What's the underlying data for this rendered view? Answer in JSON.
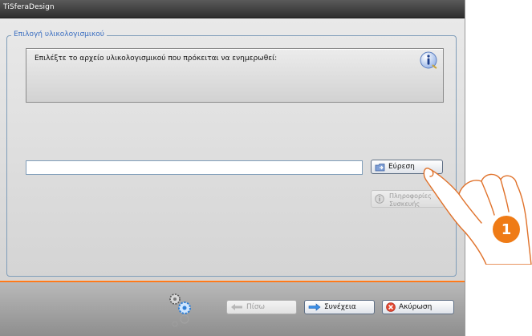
{
  "window": {
    "title": "TiSferaDesign"
  },
  "group": {
    "legend": "Επιλογή υλικολογισμικού"
  },
  "prompt": {
    "text": "Επιλέξτε το αρχείο υλικολογισμικού που πρόκειται να ενημερωθεί:"
  },
  "path_field": {
    "value": ""
  },
  "buttons": {
    "browse": "Εύρεση",
    "info": "Πληροφορίες Συσκευής",
    "back": "Πίσω",
    "next": "Συνέχεια",
    "cancel": "Ακύρωση"
  },
  "callout": {
    "number": "1"
  },
  "colors": {
    "accent_orange": "#ff7a1a",
    "title_bar": "#3a3a3a",
    "legend_blue": "#3a6ec0"
  },
  "icons": [
    "info-icon",
    "browse-folder-icon",
    "info-small-icon",
    "gears-icon",
    "back-arrow-icon",
    "next-arrow-icon",
    "cancel-icon",
    "pointing-hand"
  ]
}
